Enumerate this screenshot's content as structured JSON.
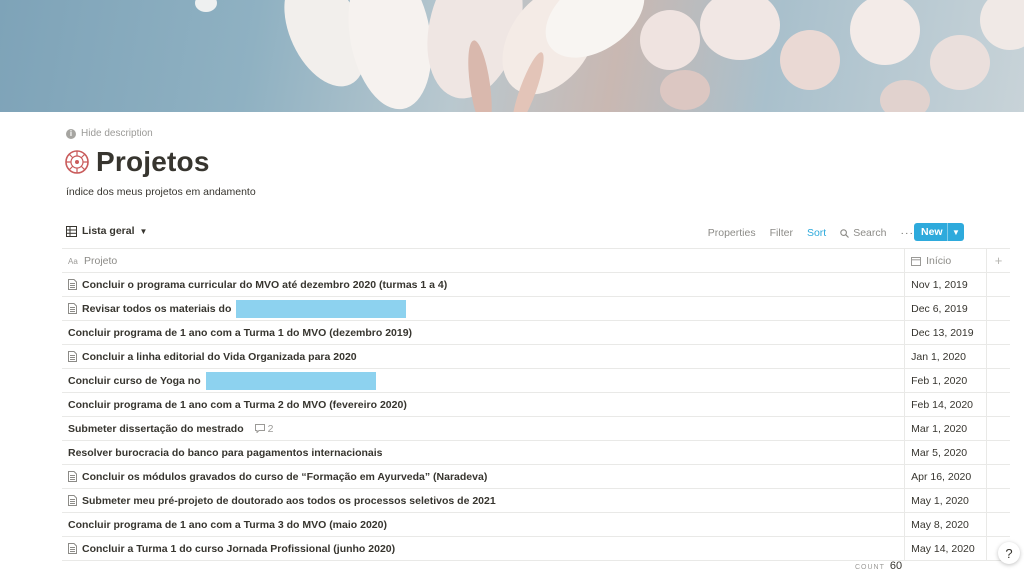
{
  "page": {
    "hide_description": "Hide description",
    "title": "Projetos",
    "description": "índice dos meus projetos em andamento"
  },
  "toolbar": {
    "view_name": "Lista geral",
    "properties": "Properties",
    "filter": "Filter",
    "sort": "Sort",
    "search": "Search",
    "more": "···",
    "new": "New"
  },
  "table": {
    "headers": {
      "project": "Projeto",
      "start": "Início"
    },
    "rows": [
      {
        "name": "Concluir o programa curricular do MVO até dezembro 2020 (turmas 1 a 4)",
        "date": "Nov 1, 2019",
        "doc": true
      },
      {
        "name": "Revisar todos os materiais do",
        "date": "Dec 6, 2019",
        "doc": true,
        "redacted": true
      },
      {
        "name": "Concluir programa de 1 ano com a Turma 1 do MVO (dezembro 2019)",
        "date": "Dec 13, 2019",
        "doc": false
      },
      {
        "name": "Concluir a linha editorial do Vida Organizada para 2020",
        "date": "Jan 1, 2020",
        "doc": true
      },
      {
        "name": "Concluir curso de Yoga no",
        "date": "Feb 1, 2020",
        "doc": false,
        "redacted": true
      },
      {
        "name": "Concluir programa de 1 ano com a Turma 2 do MVO (fevereiro 2020)",
        "date": "Feb 14, 2020",
        "doc": false
      },
      {
        "name": "Submeter dissertação do mestrado",
        "date": "Mar 1, 2020",
        "doc": false,
        "comments": "2"
      },
      {
        "name": "Resolver burocracia do banco para pagamentos internacionais",
        "date": "Mar 5, 2020",
        "doc": false
      },
      {
        "name": "Concluir os módulos gravados do curso de “Formação em Ayurveda” (Naradeva)",
        "date": "Apr 16, 2020",
        "doc": true
      },
      {
        "name": "Submeter meu pré-projeto de doutorado aos todos os processos seletivos de 2021",
        "date": "May 1, 2020",
        "doc": true
      },
      {
        "name": "Concluir programa de 1 ano com a Turma 3 do MVO (maio 2020)",
        "date": "May 8, 2020",
        "doc": false
      },
      {
        "name": "Concluir a Turma 1 do curso Jornada Profissional (junho 2020)",
        "date": "May 14, 2020",
        "doc": true
      }
    ]
  },
  "footer": {
    "count_label": "COUNT",
    "count_value": "60",
    "help": "?"
  },
  "colors": {
    "accent": "#2eaadc",
    "redaction": "#8dd2ef"
  },
  "icons": {
    "hide_description": "info-icon",
    "page": "mandala-icon",
    "view": "table-icon",
    "search": "search-icon",
    "header_project": "text-icon",
    "header_start": "calendar-icon",
    "row_doc": "document-icon",
    "comment": "comment-icon"
  }
}
